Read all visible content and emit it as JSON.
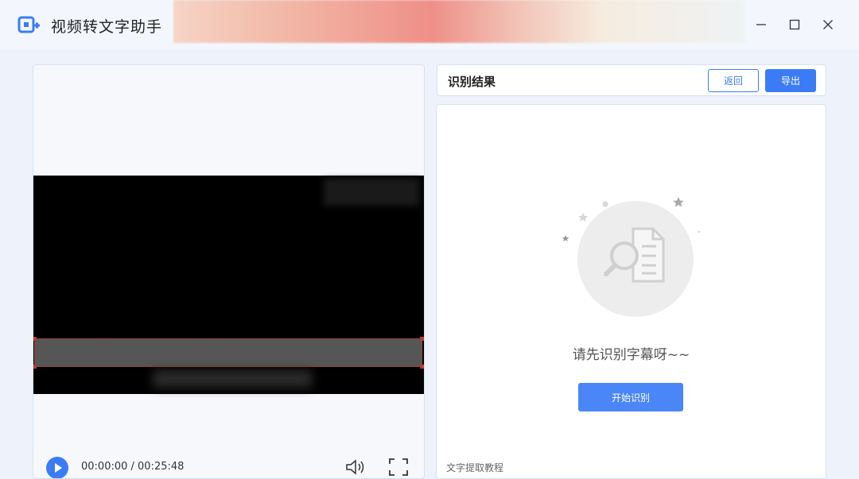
{
  "app": {
    "title": "视频转文字助手"
  },
  "player": {
    "time": "00:00:00 / 00:25:48"
  },
  "result": {
    "title": "识别结果",
    "back_label": "返回",
    "export_label": "导出",
    "empty_message": "请先识别字幕呀~~",
    "start_label": "开始识别",
    "bottom_link": "文字提取教程"
  },
  "colors": {
    "accent": "#3b7cf5",
    "region_border": "#c0392b"
  }
}
